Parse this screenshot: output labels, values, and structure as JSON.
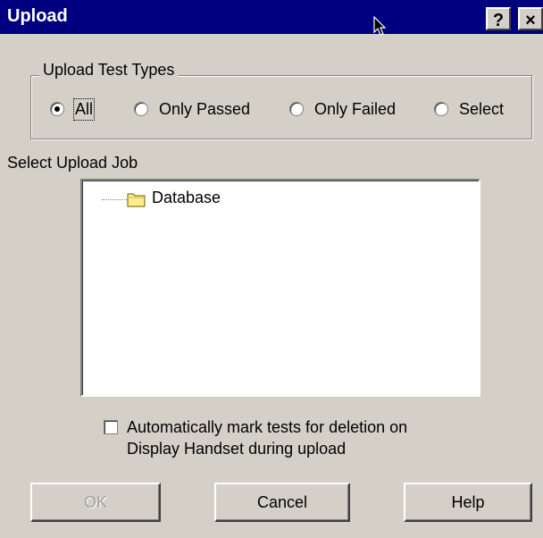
{
  "window": {
    "title": "Upload",
    "help_button": "?",
    "close_button": "×"
  },
  "test_types": {
    "legend": "Upload Test Types",
    "selected": "All",
    "options": [
      {
        "label": "All",
        "checked": true
      },
      {
        "label": "Only Passed",
        "checked": false
      },
      {
        "label": "Only Failed",
        "checked": false
      },
      {
        "label": "Select",
        "checked": false
      }
    ]
  },
  "upload_job": {
    "label": "Select Upload Job",
    "tree_items": [
      {
        "label": "Database",
        "icon": "folder-icon"
      }
    ]
  },
  "auto_mark": {
    "checked": false,
    "line1": "Automatically mark tests for deletion on",
    "line2": "Display Handset during upload"
  },
  "buttons": {
    "ok": {
      "label": "OK",
      "enabled": false
    },
    "cancel": {
      "label": "Cancel",
      "enabled": true
    },
    "help": {
      "label": "Help",
      "enabled": true
    }
  },
  "colors": {
    "titlebar": "#000080",
    "face": "#d4d0c8",
    "folder": "#ffef8a"
  }
}
